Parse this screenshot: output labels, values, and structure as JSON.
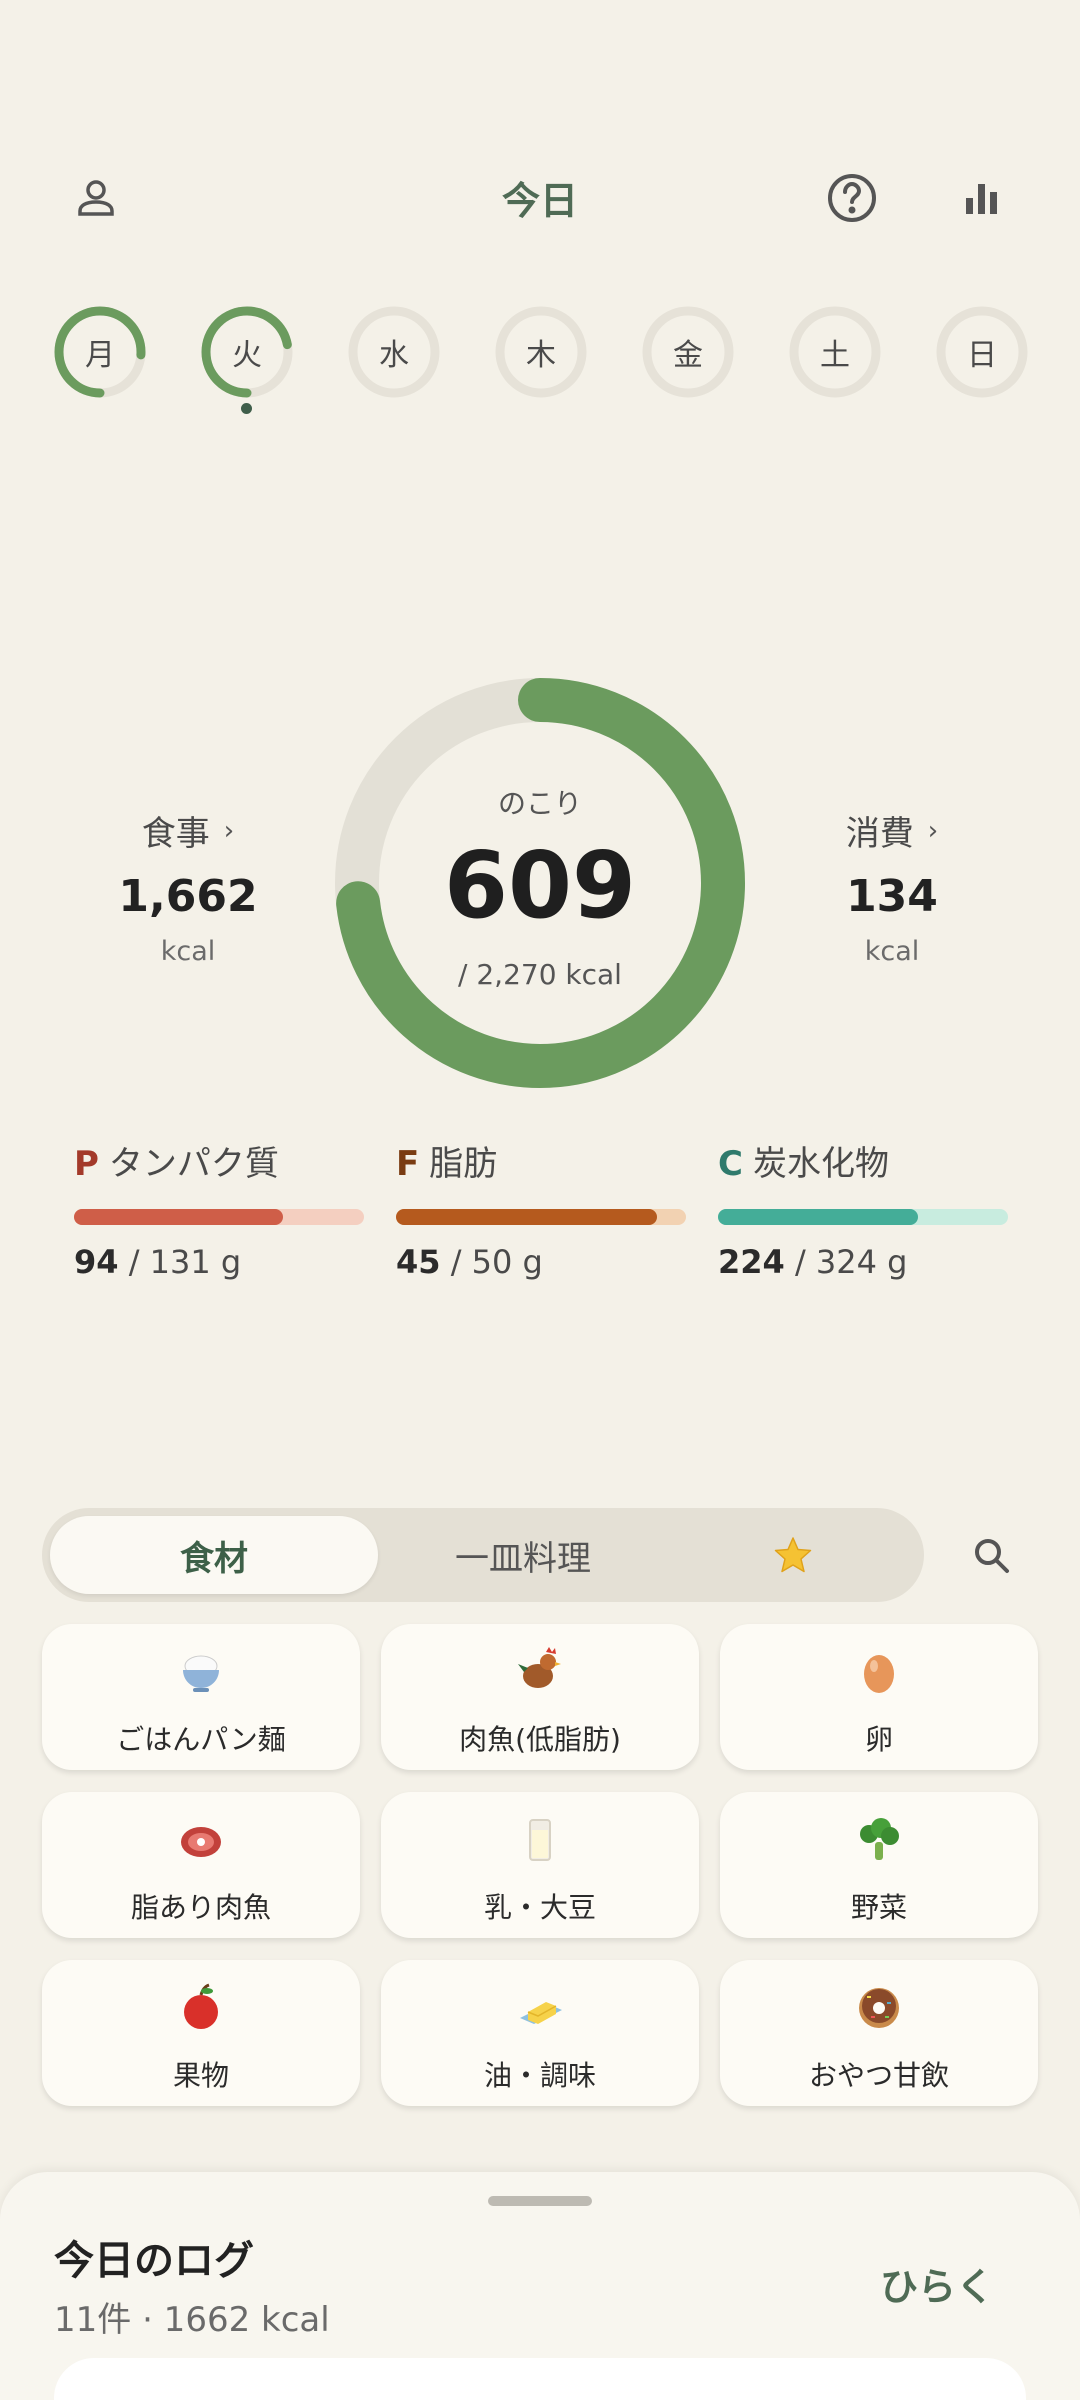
{
  "header": {
    "title": "今日"
  },
  "week": [
    {
      "label": "月",
      "progress": 0.76,
      "color": "#6b9b5e"
    },
    {
      "label": "火",
      "progress": 0.72,
      "color": "#6b9b5e"
    },
    {
      "label": "水",
      "progress": 0
    },
    {
      "label": "木",
      "progress": 0
    },
    {
      "label": "金",
      "progress": 0
    },
    {
      "label": "土",
      "progress": 0
    },
    {
      "label": "日",
      "progress": 0
    }
  ],
  "calories": {
    "meal_label": "食事",
    "meal_value": "1,662",
    "meal_unit": "kcal",
    "burn_label": "消費",
    "burn_value": "134",
    "burn_unit": "kcal",
    "remaining_label": "のこり",
    "remaining_value": "609",
    "goal_text": "/ 2,270 kcal",
    "ring_progress": 0.732,
    "ring_color": "#6b9b5e",
    "ring_track_color": "#e3e0d6"
  },
  "macros": {
    "p": {
      "letter": "P",
      "name": "タンパク質",
      "current": "94",
      "total": " / 131 g",
      "fraction": 0.72,
      "letter_color": "#a33a2a",
      "fill_color": "#cf5e48",
      "track_color": "#f4cfc0"
    },
    "f": {
      "letter": "F",
      "name": "脂肪",
      "current": "45",
      "total": " / 50 g",
      "fraction": 0.9,
      "letter_color": "#7a3c12",
      "fill_color": "#b55a1e",
      "track_color": "#f2d2b2"
    },
    "c": {
      "letter": "C",
      "name": "炭水化物",
      "current": "224",
      "total": " / 324 g",
      "fraction": 0.69,
      "letter_color": "#2f7a6c",
      "fill_color": "#44ad98",
      "track_color": "#c8ecdf"
    }
  },
  "tabs": {
    "ingredients": "食材",
    "dishes": "一皿料理",
    "favorites_icon": "star-icon"
  },
  "foods": [
    {
      "label": "ごはんパン麺",
      "icon": "rice-bowl-icon"
    },
    {
      "label": "肉魚(低脂肪)",
      "icon": "chicken-icon"
    },
    {
      "label": "卵",
      "icon": "egg-icon"
    },
    {
      "label": "脂あり肉魚",
      "icon": "meat-icon"
    },
    {
      "label": "乳・大豆",
      "icon": "milk-icon"
    },
    {
      "label": "野菜",
      "icon": "broccoli-icon"
    },
    {
      "label": "果物",
      "icon": "apple-icon"
    },
    {
      "label": "油・調味",
      "icon": "butter-icon"
    },
    {
      "label": "おやつ甘飲",
      "icon": "donut-icon"
    }
  ],
  "log": {
    "title": "今日のログ",
    "summary": "11件 · 1662 kcal",
    "open_label": "ひらく"
  }
}
